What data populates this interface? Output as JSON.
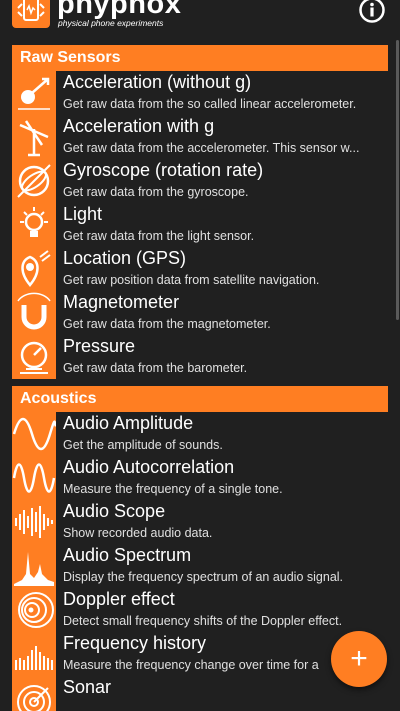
{
  "app": {
    "title": "phyphox",
    "subtitle": "physical phone experiments",
    "accent_color": "#ff7e22",
    "background_color": "#202020"
  },
  "header": {
    "logo_icon": "phone-icon",
    "info_icon": "info-icon"
  },
  "categories": [
    {
      "title": "Raw Sensors",
      "items": [
        {
          "title": "Acceleration (without g)",
          "desc": "Get raw data from the so called linear accelerometer.",
          "icon": "acceleration-icon"
        },
        {
          "title": "Acceleration with g",
          "desc": "Get raw data from the accelerometer. This sensor w...",
          "icon": "acceleration-g-icon"
        },
        {
          "title": "Gyroscope (rotation rate)",
          "desc": "Get raw data from the gyroscope.",
          "icon": "gyroscope-icon"
        },
        {
          "title": "Light",
          "desc": "Get raw data from the light sensor.",
          "icon": "light-bulb-icon"
        },
        {
          "title": "Location (GPS)",
          "desc": "Get raw position data from satellite navigation.",
          "icon": "location-icon"
        },
        {
          "title": "Magnetometer",
          "desc": "Get raw data from the magnetometer.",
          "icon": "magnet-icon"
        },
        {
          "title": "Pressure",
          "desc": "Get raw data from the barometer.",
          "icon": "barometer-icon"
        }
      ]
    },
    {
      "title": "Acoustics",
      "items": [
        {
          "title": "Audio Amplitude",
          "desc": "Get the amplitude of sounds.",
          "icon": "sine-wave-icon"
        },
        {
          "title": "Audio Autocorrelation",
          "desc": "Measure the frequency of a single tone.",
          "icon": "autocorrelation-icon"
        },
        {
          "title": "Audio Scope",
          "desc": "Show recorded audio data.",
          "icon": "audio-scope-icon"
        },
        {
          "title": "Audio Spectrum",
          "desc": "Display the frequency spectrum of an audio signal.",
          "icon": "spectrum-icon"
        },
        {
          "title": "Doppler effect",
          "desc": "Detect small frequency shifts of the Doppler effect.",
          "icon": "doppler-icon"
        },
        {
          "title": "Frequency history",
          "desc": "Measure the frequency change over time for a",
          "icon": "frequency-history-icon"
        },
        {
          "title": "Sonar",
          "desc": "",
          "icon": "sonar-icon"
        }
      ]
    }
  ],
  "fab": {
    "label": "+",
    "icon": "plus-icon"
  }
}
